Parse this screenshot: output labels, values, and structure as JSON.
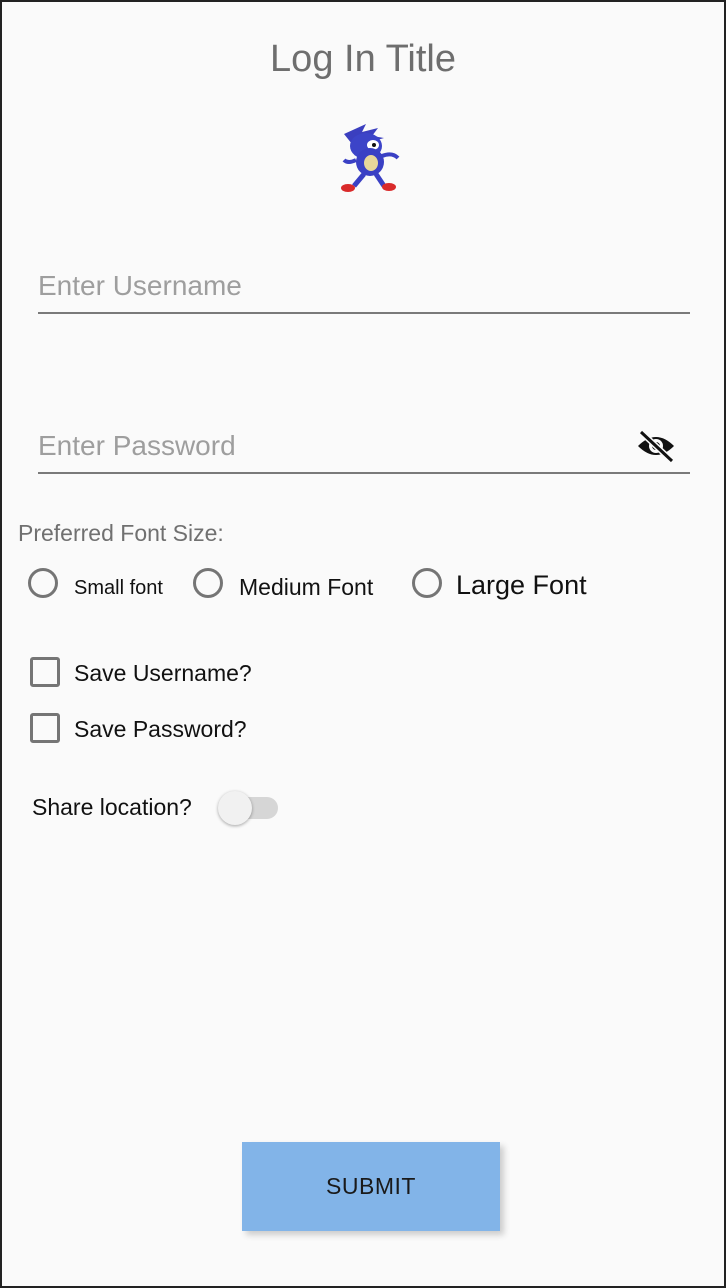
{
  "header": {
    "title": "Log In Title"
  },
  "logo": {
    "icon": "running-character-icon"
  },
  "username": {
    "placeholder": "Enter Username",
    "value": ""
  },
  "password": {
    "placeholder": "Enter Password",
    "value": "",
    "toggle_icon": "eye-off-icon"
  },
  "font_size": {
    "label": "Preferred Font Size:",
    "options": [
      {
        "label": "Small font",
        "selected": false
      },
      {
        "label": "Medium Font",
        "selected": false
      },
      {
        "label": "Large Font",
        "selected": false
      }
    ]
  },
  "checkboxes": [
    {
      "label": "Save Username?",
      "checked": false
    },
    {
      "label": "Save Password?",
      "checked": false
    }
  ],
  "share_location": {
    "label": "Share location?",
    "on": false
  },
  "submit": {
    "label": "SUBMIT",
    "color": "#82b4e8"
  }
}
